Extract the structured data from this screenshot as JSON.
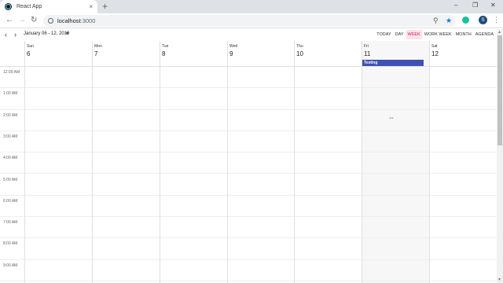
{
  "browser": {
    "tab_title": "React App",
    "tab_close": "×",
    "new_tab": "+",
    "window_controls": [
      "–",
      "❐",
      "✕"
    ],
    "url_host": "localhost",
    "url_port": ":3000",
    "profile_initial": "S",
    "icons": [
      "back-arrow-icon",
      "forward-arrow-icon",
      "reload-icon",
      "info-icon",
      "zoom-icon",
      "star-icon",
      "extension-icon",
      "menu-icon"
    ]
  },
  "calendar": {
    "date_range": "January 06 - 12, 2019",
    "views": [
      "Today",
      "Day",
      "Week",
      "Work Week",
      "Month",
      "Agenda"
    ],
    "active_view": "Week",
    "days": [
      {
        "name": "Sun",
        "num": "6"
      },
      {
        "name": "Mon",
        "num": "7"
      },
      {
        "name": "Tue",
        "num": "8"
      },
      {
        "name": "Wed",
        "num": "9"
      },
      {
        "name": "Thu",
        "num": "10"
      },
      {
        "name": "Fri",
        "num": "11"
      },
      {
        "name": "Sat",
        "num": "12"
      }
    ],
    "hours": [
      "12:00 AM",
      "1:00 AM",
      "2:00 AM",
      "3:00 AM",
      "4:00 AM",
      "5:00 AM",
      "6:00 AM",
      "7:00 AM",
      "8:00 AM",
      "9:00 AM"
    ],
    "event": {
      "title": "Testing",
      "day": "Fri"
    },
    "colors": {
      "event": "#3f51b5",
      "active_view_bg": "#fbe3e8",
      "active_view_text": "#d81b60"
    }
  }
}
